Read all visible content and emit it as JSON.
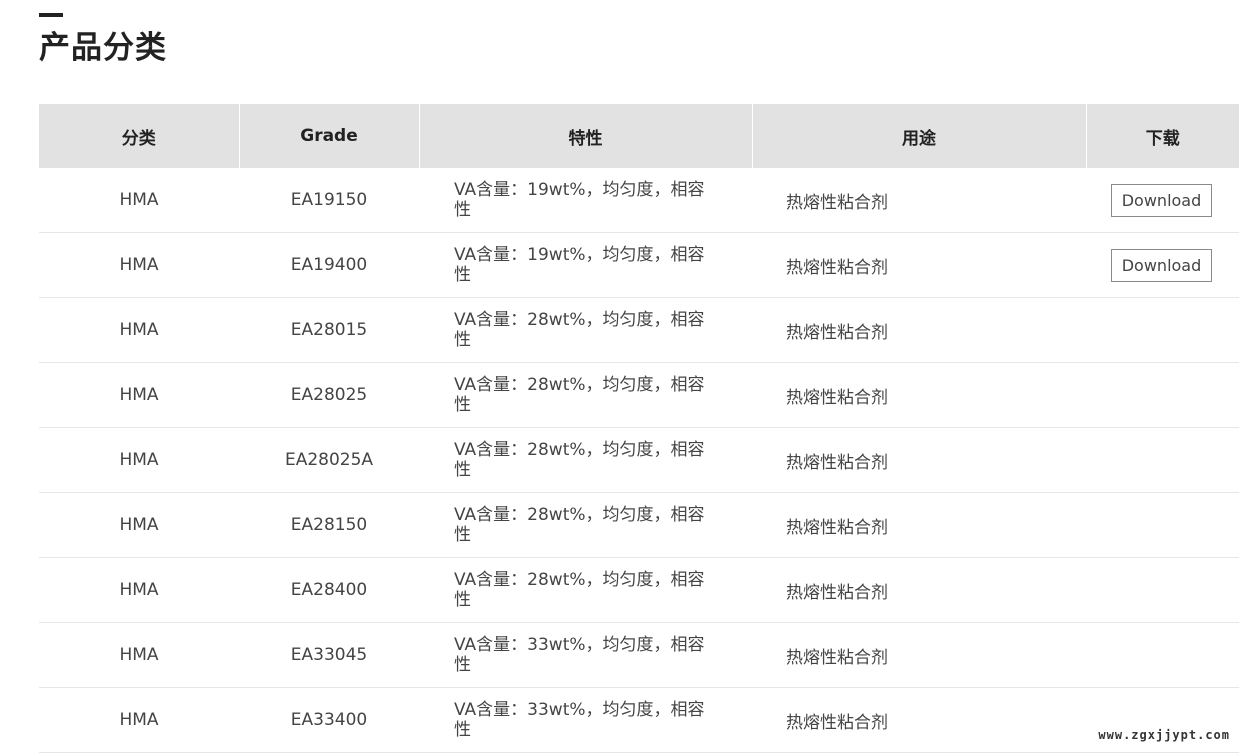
{
  "page": {
    "title": "产品分类",
    "watermark": "www.zgxjjypt.com"
  },
  "table": {
    "headers": [
      "分类",
      "Grade",
      "特性",
      "用途",
      "下载"
    ],
    "rows": [
      {
        "category": "HMA",
        "grade": "EA19150",
        "feature": "VA含量：19wt%，均匀度，相容性",
        "use": "热熔性粘合剂",
        "download": "Download"
      },
      {
        "category": "HMA",
        "grade": "EA19400",
        "feature": "VA含量：19wt%，均匀度，相容性",
        "use": "热熔性粘合剂",
        "download": "Download"
      },
      {
        "category": "HMA",
        "grade": "EA28015",
        "feature": "VA含量：28wt%，均匀度，相容性",
        "use": "热熔性粘合剂",
        "download": ""
      },
      {
        "category": "HMA",
        "grade": "EA28025",
        "feature": "VA含量：28wt%，均匀度，相容性",
        "use": "热熔性粘合剂",
        "download": ""
      },
      {
        "category": "HMA",
        "grade": "EA28025A",
        "feature": "VA含量：28wt%，均匀度，相容性",
        "use": "热熔性粘合剂",
        "download": ""
      },
      {
        "category": "HMA",
        "grade": "EA28150",
        "feature": "VA含量：28wt%，均匀度，相容性",
        "use": "热熔性粘合剂",
        "download": ""
      },
      {
        "category": "HMA",
        "grade": "EA28400",
        "feature": "VA含量：28wt%，均匀度，相容性",
        "use": "热熔性粘合剂",
        "download": ""
      },
      {
        "category": "HMA",
        "grade": "EA33045",
        "feature": "VA含量：33wt%，均匀度，相容性",
        "use": "热熔性粘合剂",
        "download": ""
      },
      {
        "category": "HMA",
        "grade": "EA33400",
        "feature": "VA含量：33wt%，均匀度，相容性",
        "use": "热熔性粘合剂",
        "download": ""
      }
    ]
  }
}
